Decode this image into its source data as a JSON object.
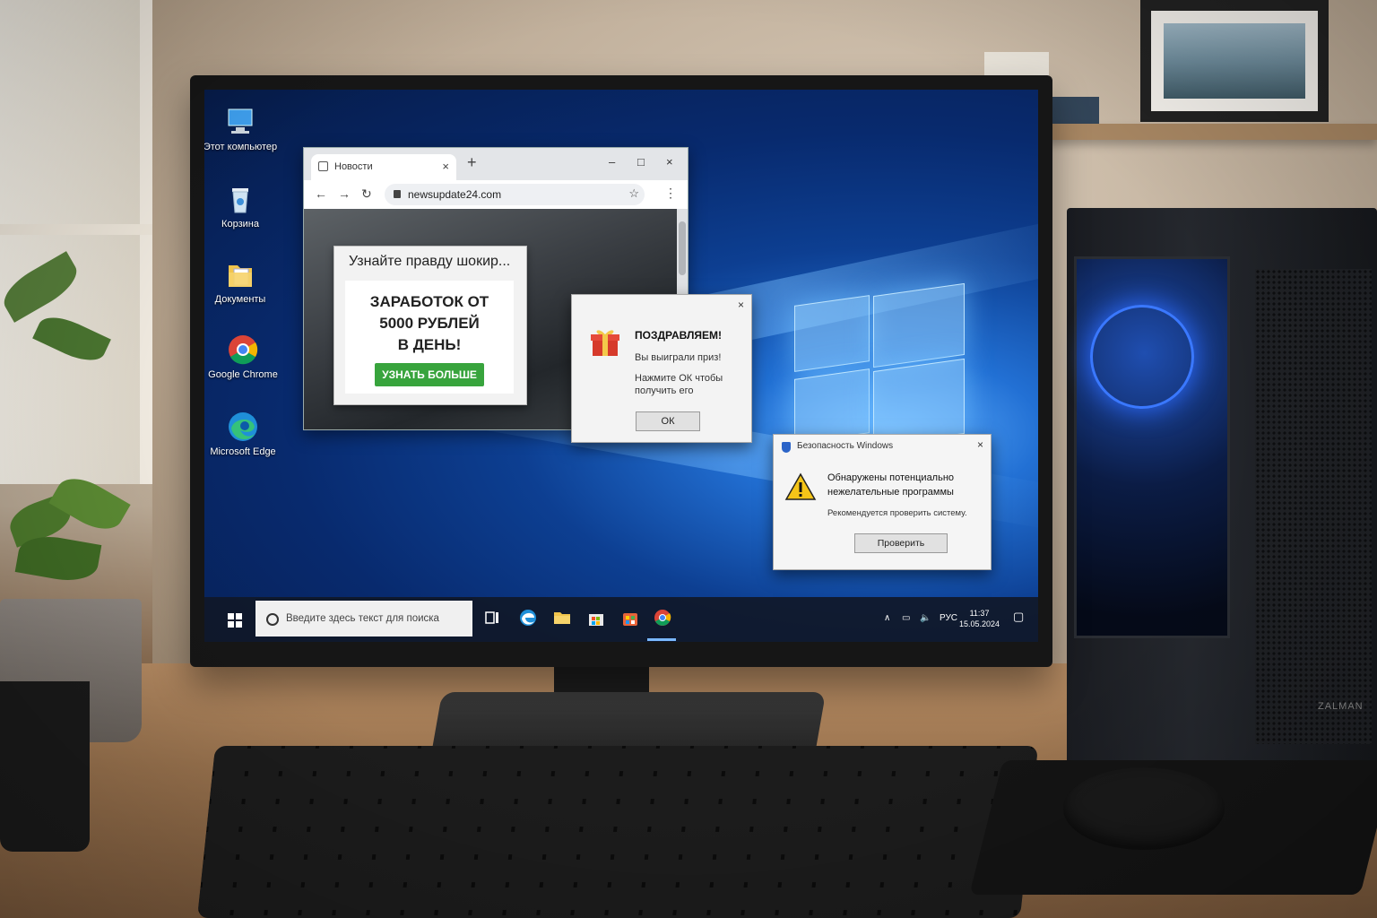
{
  "desktop": {
    "icons": [
      {
        "label": "Этот компьютер",
        "icon": "computer-icon"
      },
      {
        "label": "Корзина",
        "icon": "recycle-bin-icon"
      },
      {
        "label": "Документы",
        "icon": "folder-icon"
      },
      {
        "label": "Google Chrome",
        "icon": "chrome-icon"
      },
      {
        "label": "Microsoft Edge",
        "icon": "edge-icon"
      }
    ]
  },
  "browser": {
    "tab_title": "Новости",
    "tab_close": "×",
    "new_tab": "+",
    "url": "newsupdate24.com",
    "window_controls": {
      "minimize": "–",
      "maximize": "□",
      "close": "×"
    },
    "nav": {
      "back": "←",
      "forward": "→",
      "reload": "↻"
    },
    "bookmark": "☆",
    "menu": "⋮"
  },
  "ad_popup": {
    "header": "Узнайте правду шокир...",
    "headline_line1": "ЗАРАБОТОК ОТ",
    "headline_line2": "5000 РУБЛЕЙ",
    "headline_line3": "В ДЕНЬ!",
    "button": "УЗНАТЬ БОЛЬШЕ",
    "button_color": "#38a43d"
  },
  "prize_dialog": {
    "title": "ПОЗДРАВЛЯЕМ!",
    "line1": "Вы выиграли приз!",
    "line2": "Нажмите ОК чтобы получить его",
    "ok_button": "ОК",
    "close": "×",
    "icon": "gift-icon"
  },
  "security_dialog": {
    "title": "Безопасность Windows",
    "message": "Обнаружены потенциально нежелательные программы",
    "recommendation": "Рекомендуется проверить систему.",
    "button": "Проверить",
    "close": "×",
    "icon": "warning-icon"
  },
  "taskbar": {
    "search_placeholder": "Введите здесь текст для поиска",
    "language": "РУС",
    "time": "11:37",
    "date": "15.05.2024",
    "apps": [
      "task-view-icon",
      "edge-icon",
      "file-explorer-icon",
      "store-icon",
      "office-icon",
      "chrome-icon"
    ],
    "tray": {
      "chevron": "∧",
      "network": "▭",
      "volume": "🔈",
      "notifications": "▢"
    }
  },
  "hardware": {
    "case_brand": "ZALMAN"
  }
}
